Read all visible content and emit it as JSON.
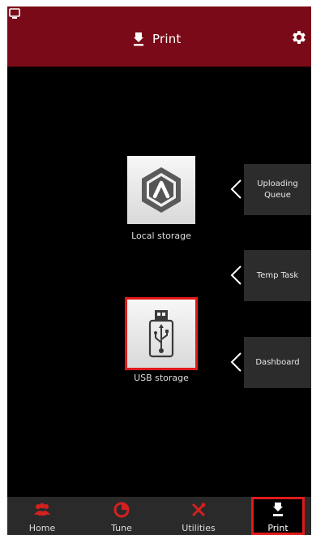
{
  "header": {
    "title": "Print"
  },
  "storage": {
    "local_label": "Local storage",
    "usb_label": "USB storage"
  },
  "side_buttons": {
    "uploading_queue": "Uploading\nQueue",
    "temp_task": "Temp Task",
    "dashboard": "Dashboard"
  },
  "nav": {
    "home": "Home",
    "tune": "Tune",
    "utilities": "Utilities",
    "print": "Print"
  },
  "colors": {
    "header_bg": "#7a0a17",
    "accent_red": "#e01a1a",
    "side_button_bg": "#2c2c2c",
    "nav_bg": "#2a2a2a"
  },
  "icons": {
    "device": "device-monitor-icon",
    "print": "print-nozzle-icon",
    "settings": "gear-icon",
    "local_storage": "hexagon-logo-icon",
    "usb_storage": "usb-drive-icon",
    "home": "people-icon",
    "tune": "pie-chart-icon",
    "utilities": "tools-icon"
  }
}
